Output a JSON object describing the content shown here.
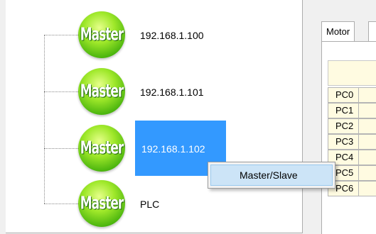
{
  "tree": {
    "node_icon_text": "Master",
    "nodes": [
      {
        "label": "192.168.1.100",
        "selected": false
      },
      {
        "label": "192.168.1.101",
        "selected": false
      },
      {
        "label": "192.168.1.102",
        "selected": true
      },
      {
        "label": "PLC",
        "selected": false
      }
    ]
  },
  "tabs": [
    {
      "label": "Motor"
    }
  ],
  "pc_table": {
    "rows": [
      "PC0",
      "PC1",
      "PC2",
      "PC3",
      "PC4",
      "PC5",
      "PC6"
    ]
  },
  "context_menu": {
    "items": [
      {
        "label": "Master/Slave"
      }
    ]
  },
  "colors": {
    "selection": "#3399ff",
    "menu_hover": "#cce4f7",
    "cell_bg": "#fffbe1",
    "node_green": "#45b10c"
  }
}
